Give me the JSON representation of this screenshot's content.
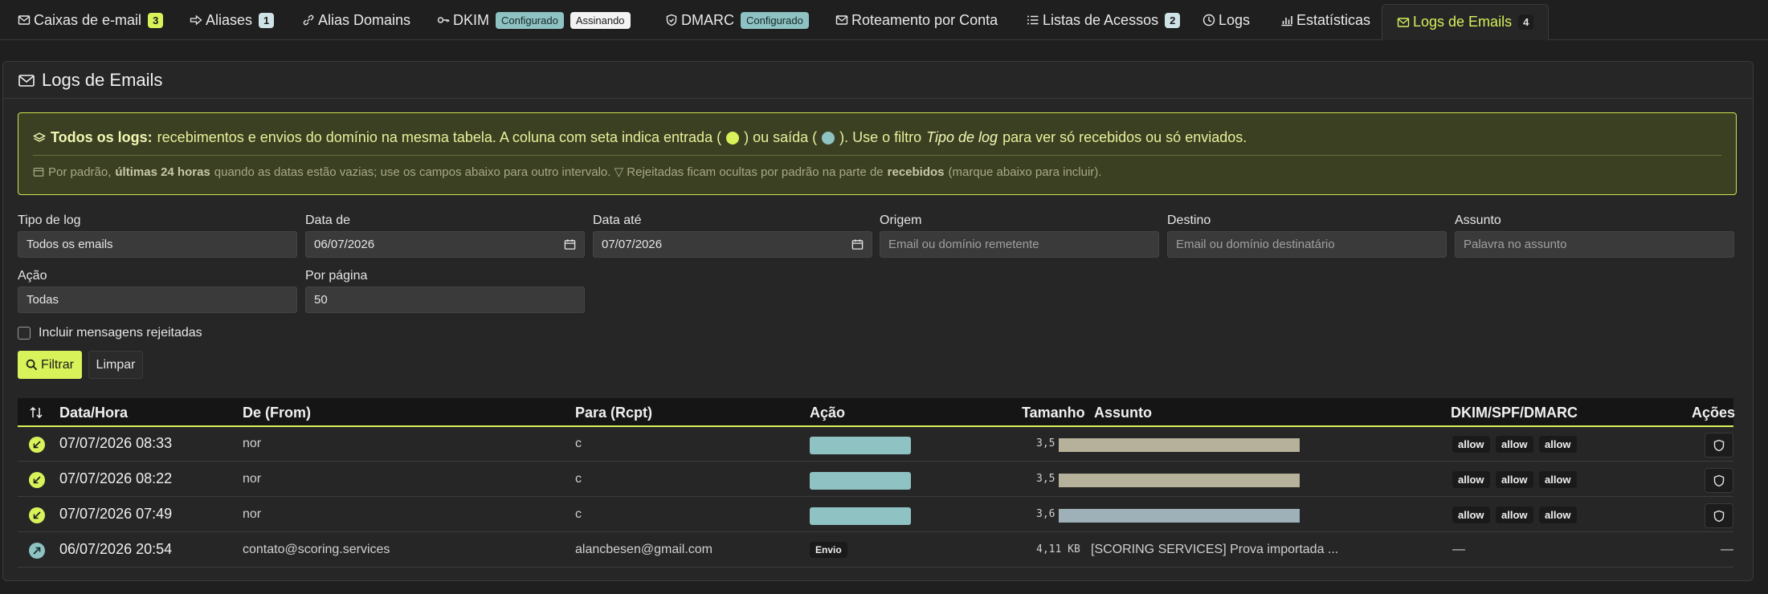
{
  "tabs": [
    {
      "label": "Caixas de e-mail",
      "badge": "3"
    },
    {
      "label": "Aliases",
      "badge": "1"
    },
    {
      "label": "Alias Domains"
    },
    {
      "label": "DKIM",
      "badge1": "Configurado",
      "badge2": "Assinando"
    },
    {
      "label": "DMARC",
      "badge1": "Configurado"
    },
    {
      "label": "Roteamento por Conta"
    },
    {
      "label": "Listas de Acessos",
      "badge": "2"
    },
    {
      "label": "Logs"
    },
    {
      "label": "Estatísticas"
    },
    {
      "label": "Logs de Emails",
      "badge": "4"
    }
  ],
  "card": {
    "title": "Logs de Emails",
    "info": {
      "bold": "Todos os logs:",
      "t1": "recebimentos e envios do domínio na mesma tabela. A coluna com seta indica entrada (",
      "t2": ") ou saída (",
      "t3": "). Use o filtro",
      "italic": "Tipo de log",
      "t4": "para ver só recebidos ou só enviados.",
      "n1": "Por padrão,",
      "n_bold1": "últimas 24 horas",
      "n2": "quando as datas estão vazias; use os campos abaixo para outro intervalo. ▽ Rejeitadas ficam ocultas por padrão na parte de",
      "n_bold2": "recebidos",
      "n3": "(marque abaixo para incluir)."
    }
  },
  "filters": {
    "tipo_label": "Tipo de log",
    "tipo_value": "Todos os emails",
    "data_de_label": "Data de",
    "data_de_value": "06/07/2026",
    "data_ate_label": "Data até",
    "data_ate_value": "07/07/2026",
    "origem_label": "Origem",
    "origem_placeholder": "Email ou domínio remetente",
    "destino_label": "Destino",
    "destino_placeholder": "Email ou domínio destinatário",
    "assunto_label": "Assunto",
    "assunto_placeholder": "Palavra no assunto",
    "acao_label": "Ação",
    "acao_value": "Todas",
    "por_pagina_label": "Por página",
    "por_pagina_value": "50",
    "incluir_label": "Incluir mensagens rejeitadas",
    "filtrar_label": "Filtrar",
    "limpar_label": "Limpar"
  },
  "table": {
    "headers": {
      "datahora": "Data/Hora",
      "de": "De (From)",
      "para": "Para (Rcpt)",
      "acao": "Ação",
      "tamanho": "Tamanho",
      "assunto": "Assunto",
      "auth": "DKIM/SPF/DMARC",
      "acoes": "Ações"
    },
    "rows": [
      {
        "direction": "in",
        "datetime": "07/07/2026 08:33",
        "from": "nor",
        "to": "c",
        "size": "3,5",
        "auth": [
          "allow",
          "allow",
          "allow"
        ]
      },
      {
        "direction": "in",
        "datetime": "07/07/2026 08:22",
        "from": "nor",
        "to": "c",
        "size": "3,5",
        "auth": [
          "allow",
          "allow",
          "allow"
        ]
      },
      {
        "direction": "in",
        "datetime": "07/07/2026 07:49",
        "from": "nor",
        "to": "c",
        "size": "3,6",
        "auth": [
          "allow",
          "allow",
          "allow"
        ]
      },
      {
        "direction": "out",
        "datetime": "06/07/2026 20:54",
        "from": "contato@scoring.services",
        "to": "alancbesen@gmail.com",
        "action": "Envio",
        "size": "4,11 KB",
        "subject": "[SCORING SERVICES] Prova importada ...",
        "auth_text": "—",
        "actions_text": "—"
      }
    ]
  },
  "colors": {
    "accent": "#d8f25a",
    "teal": "#8fc2c2",
    "bg": "#1f1f1f",
    "card": "#262626"
  }
}
